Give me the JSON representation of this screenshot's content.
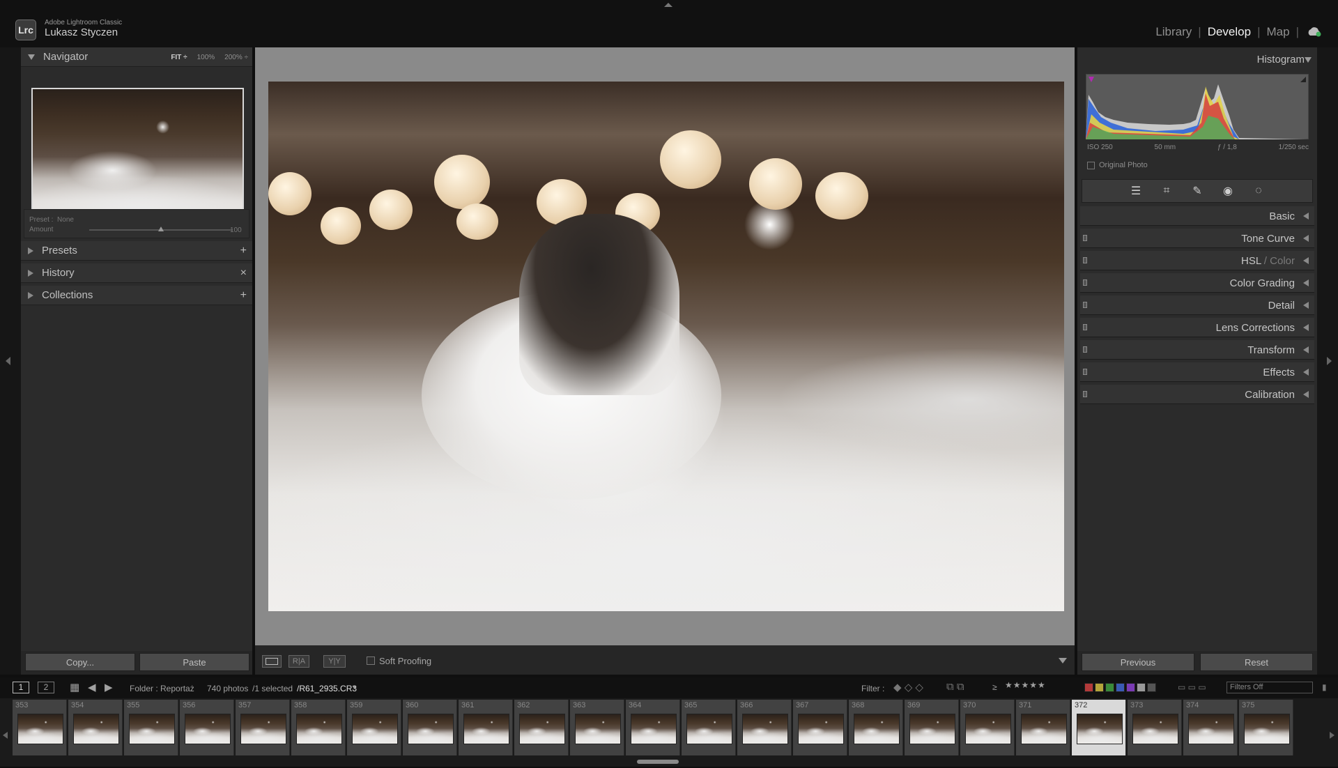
{
  "app": {
    "product_name": "Adobe Lightroom Classic",
    "logo_text": "Lrc",
    "user_name": "Lukasz Styczen"
  },
  "modules": [
    {
      "label": "Library",
      "active": false
    },
    {
      "label": "Develop",
      "active": true
    },
    {
      "label": "Map",
      "active": false
    }
  ],
  "navigator": {
    "title": "Navigator",
    "zoom": [
      "FIT ÷",
      "100%",
      "200% ÷"
    ]
  },
  "preset_strip": {
    "preset_label": "Preset :",
    "preset_value": "None",
    "amount_label": "Amount",
    "amount_value": "100",
    "amount_level": 0.5
  },
  "left_sections": [
    {
      "label": "Presets",
      "action": "+"
    },
    {
      "label": "History",
      "action": "×"
    },
    {
      "label": "Collections",
      "action": "+"
    }
  ],
  "left_buttons": {
    "copy": "Copy...",
    "paste": "Paste"
  },
  "toolbar": {
    "view_ra": "R|A",
    "view_yy": "Y|Y",
    "soft_proofing": "Soft Proofing"
  },
  "histogram": {
    "title": "Histogram",
    "iso": "ISO 250",
    "focal": "50 mm",
    "aperture": "ƒ / 1,8",
    "shutter": "1/250 sec",
    "original_photo": "Original Photo"
  },
  "right_sections": [
    {
      "label": "Basic"
    },
    {
      "label": "Tone Curve"
    },
    {
      "label": "HSL",
      "suffix": " / Color"
    },
    {
      "label": "Color Grading"
    },
    {
      "label": "Detail"
    },
    {
      "label": "Lens Corrections"
    },
    {
      "label": "Transform"
    },
    {
      "label": "Effects"
    },
    {
      "label": "Calibration"
    }
  ],
  "right_buttons": {
    "previous": "Previous",
    "reset": "Reset"
  },
  "filmstrip": {
    "screens": [
      "1",
      "2"
    ],
    "folder": "Folder : Reportaż",
    "count": "740 photos",
    "selected": "/1 selected",
    "file": "/R61_2935.CR3",
    "filter_label": "Filter :",
    "filters_off": "Filters Off",
    "rating_op": "≥",
    "label_colors": [
      "#b33a3a",
      "#b3a43a",
      "#3a8a3a",
      "#3a5ab3",
      "#7a3ab3",
      "#9a9a9a",
      "#555555"
    ],
    "frames": [
      "353",
      "354",
      "355",
      "356",
      "357",
      "358",
      "359",
      "360",
      "361",
      "362",
      "363",
      "364",
      "365",
      "366",
      "367",
      "368",
      "369",
      "370",
      "371",
      "372",
      "373",
      "374",
      "375"
    ],
    "selected_frame": "372"
  }
}
